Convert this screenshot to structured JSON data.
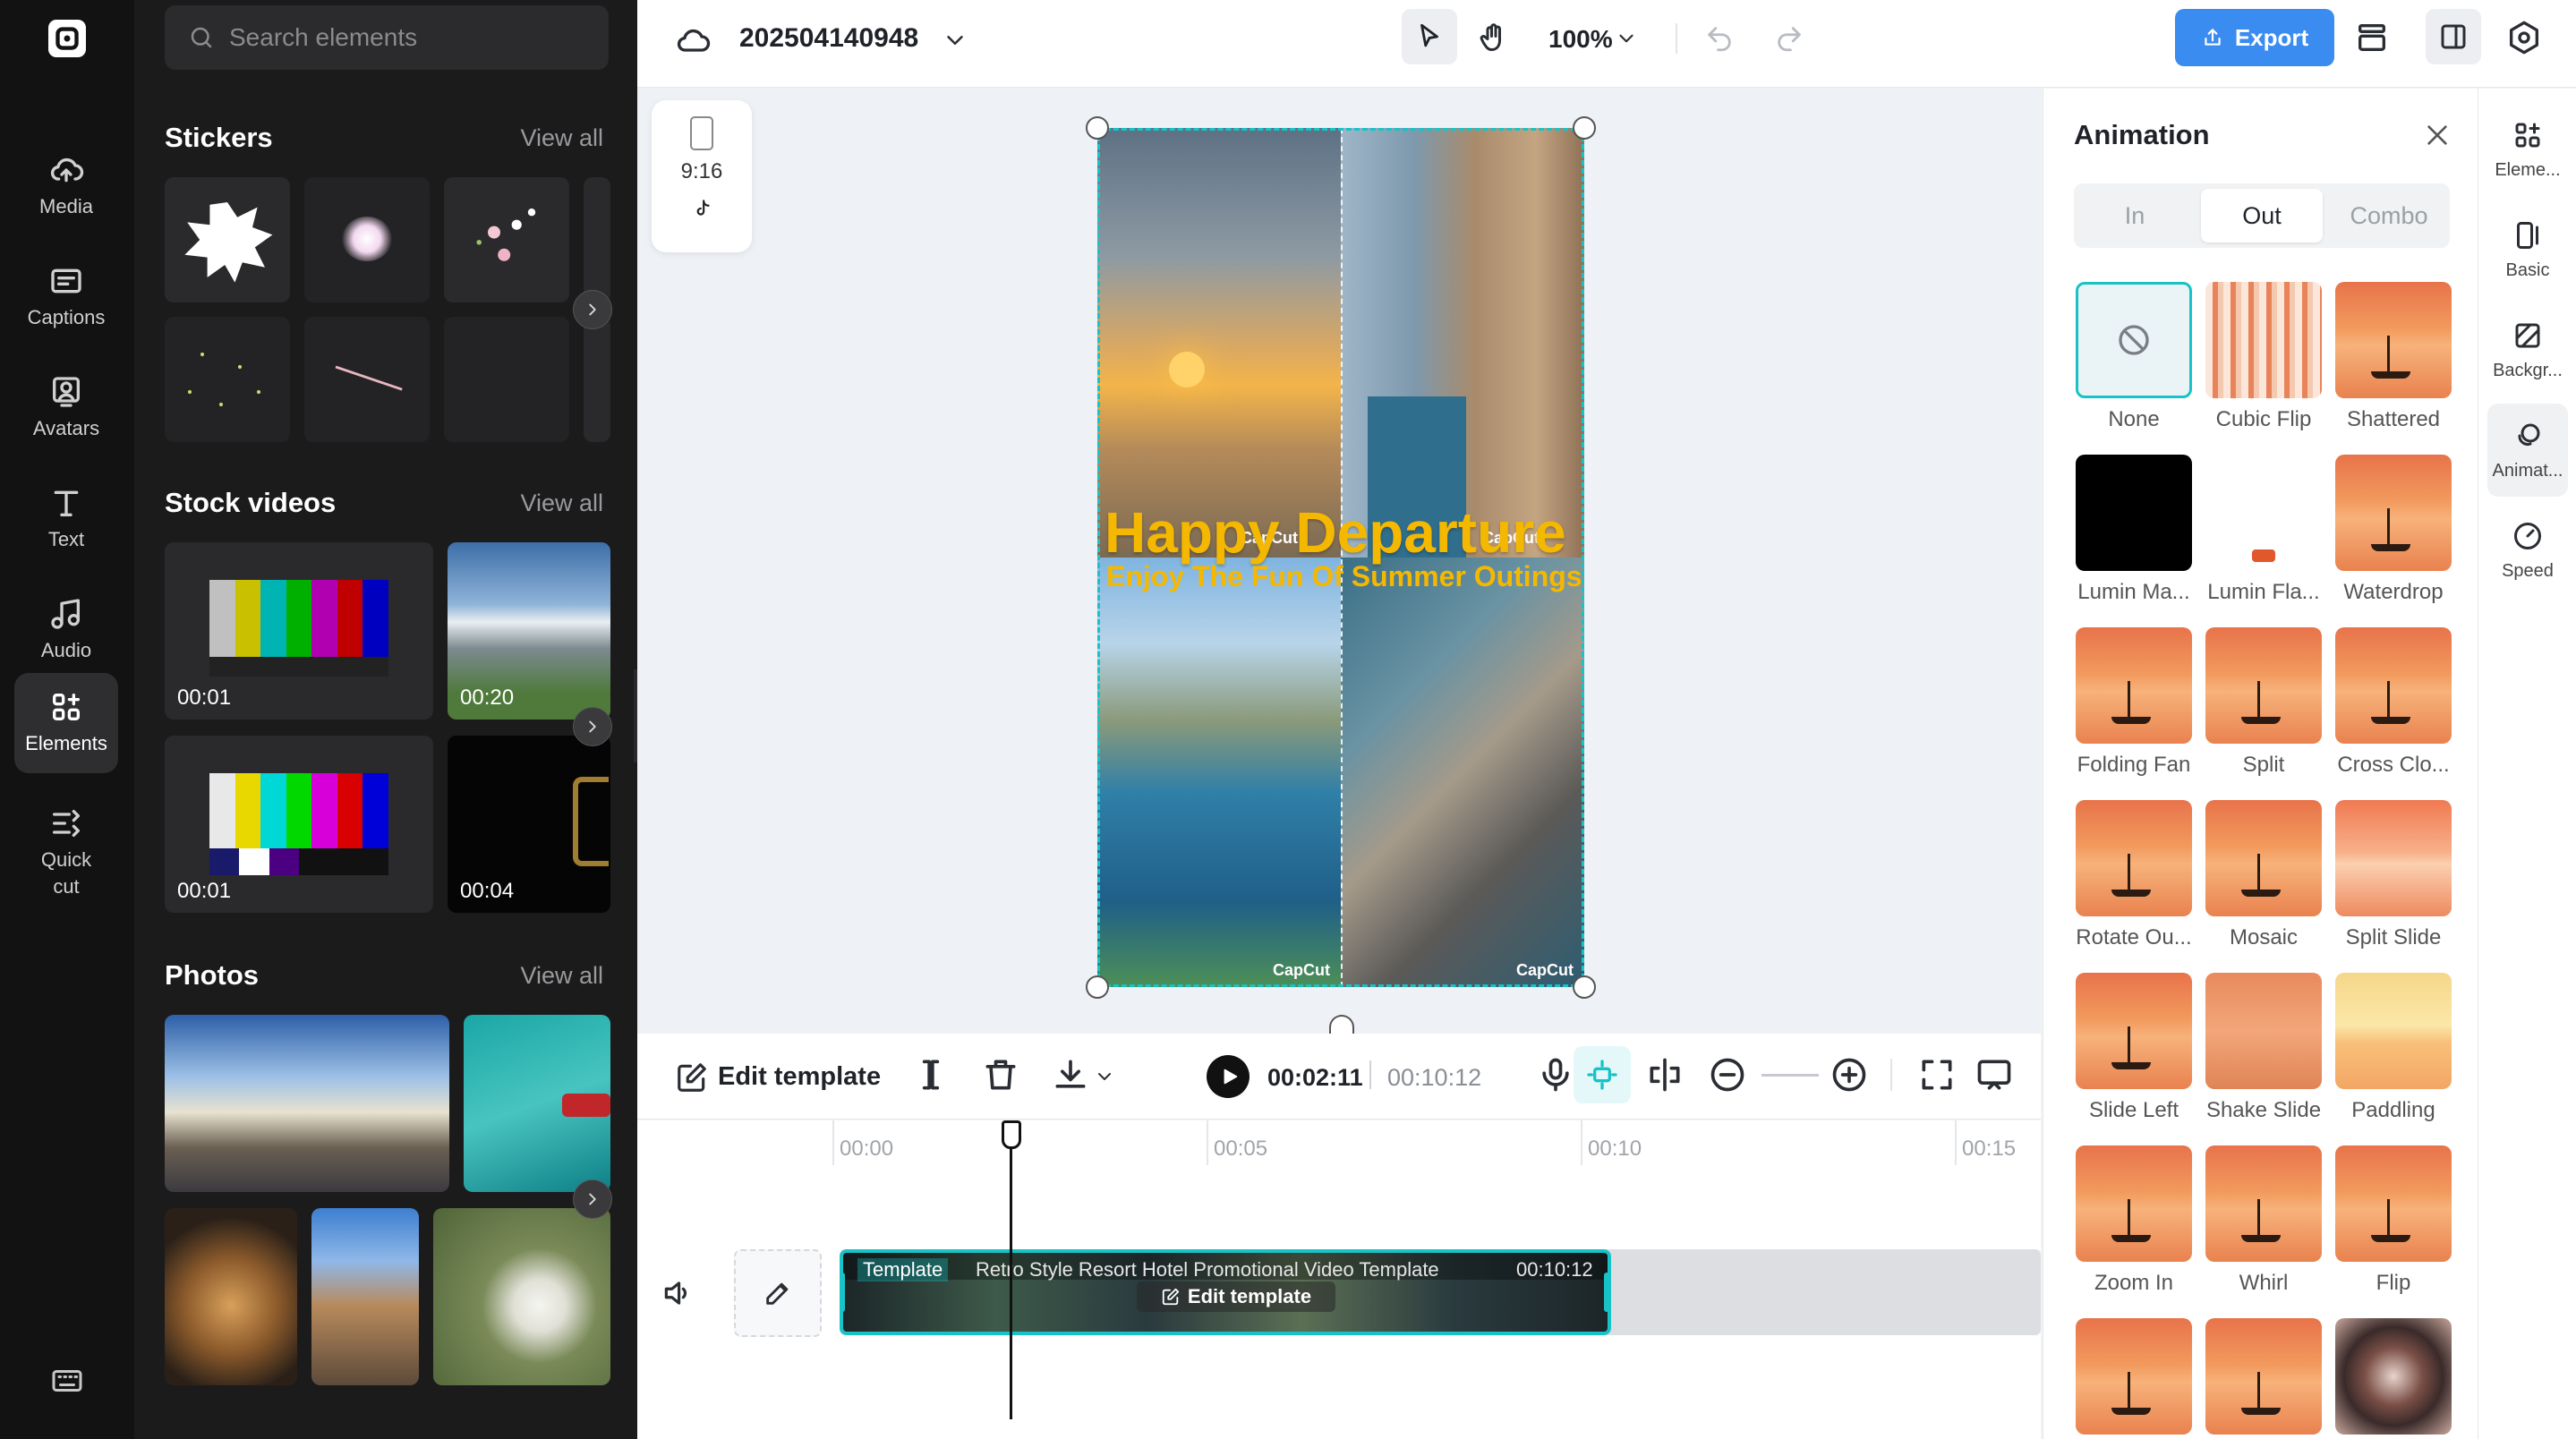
{
  "left_nav": {
    "items": [
      {
        "label": "Media",
        "icon": "cloud-upload-icon"
      },
      {
        "label": "Captions",
        "icon": "captions-icon"
      },
      {
        "label": "Avatars",
        "icon": "avatar-icon"
      },
      {
        "label": "Text",
        "icon": "text-icon"
      },
      {
        "label": "Audio",
        "icon": "music-note-icon"
      },
      {
        "label": "Elements",
        "icon": "elements-icon"
      },
      {
        "label": "Quick cut",
        "icon": "quick-cut-icon"
      }
    ],
    "active": "Elements"
  },
  "panel": {
    "search_placeholder": "Search elements",
    "stickers": {
      "title": "Stickers",
      "view_all": "View all"
    },
    "stock_videos": {
      "title": "Stock videos",
      "view_all": "View all",
      "durations": [
        "00:01",
        "00:20",
        "00:01",
        "00:04"
      ]
    },
    "photos": {
      "title": "Photos",
      "view_all": "View all"
    }
  },
  "topbar": {
    "project_name": "202504140948",
    "zoom": "100%",
    "export_label": "Export",
    "accent": "#3b8cf0"
  },
  "canvas": {
    "ratio_label": "9:16",
    "poster_title": "Happy Departure",
    "poster_subtitle": "Enjoy The Fun Of Summer Outings",
    "watermark": "CapCut"
  },
  "toolbar": {
    "edit_template": "Edit template",
    "current_time": "00:02:11",
    "total_time": "00:10:12"
  },
  "timeline": {
    "ruler": [
      "00:00",
      "00:05",
      "00:10",
      "00:15"
    ],
    "clip": {
      "tag": "Template",
      "title": "Retro Style Resort Hotel Promotional Video Template",
      "duration": "00:10:12",
      "edit_label": "Edit template"
    }
  },
  "animation": {
    "title": "Animation",
    "tabs": [
      "In",
      "Out",
      "Combo"
    ],
    "active_tab": "Out",
    "items": [
      "None",
      "Cubic Flip",
      "Shattered",
      "Lumin Ma...",
      "Lumin Fla...",
      "Waterdrop",
      "Folding Fan",
      "Split",
      "Cross Clo...",
      "Rotate Ou...",
      "Mosaic",
      "Split Slide",
      "Slide Left",
      "Shake Slide",
      "Paddling",
      "Zoom In",
      "Whirl",
      "Flip",
      "",
      "",
      ""
    ]
  },
  "right_nav": {
    "items": [
      "Eleme...",
      "Basic",
      "Backgr...",
      "Animat...",
      "Speed"
    ],
    "active": "Animat..."
  }
}
